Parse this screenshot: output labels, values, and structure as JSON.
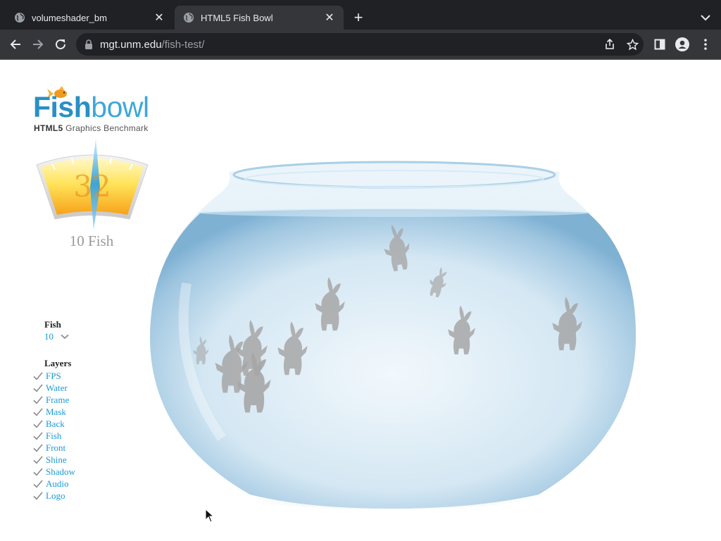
{
  "browser": {
    "tabs": [
      {
        "title": "volumeshader_bm",
        "icon": "globe-icon",
        "active": false
      },
      {
        "title": "HTML5 Fish Bowl",
        "icon": "globe-icon",
        "active": true
      }
    ],
    "url_host": "mgt.unm.edu",
    "url_path": "/fish-test/"
  },
  "page": {
    "logo": {
      "word_bold": "Fish",
      "word_thin": "bowl",
      "sub_bold": "HTML5",
      "sub_rest": " Graphics Benchmark"
    },
    "gauge": {
      "fps": "32"
    },
    "fish_count_label": "10 Fish",
    "controls": {
      "fish_heading": "Fish",
      "fish_value": "10",
      "layers_heading": "Layers",
      "layers": [
        "FPS",
        "Water",
        "Frame",
        "Mask",
        "Back",
        "Fish",
        "Front",
        "Shine",
        "Shadow",
        "Audio",
        "Logo"
      ]
    }
  },
  "colors": {
    "accent": "#1a9ad6",
    "logo_blue": "#2a8fc4",
    "chrome_dark": "#202124",
    "chrome_mid": "#35363a"
  }
}
